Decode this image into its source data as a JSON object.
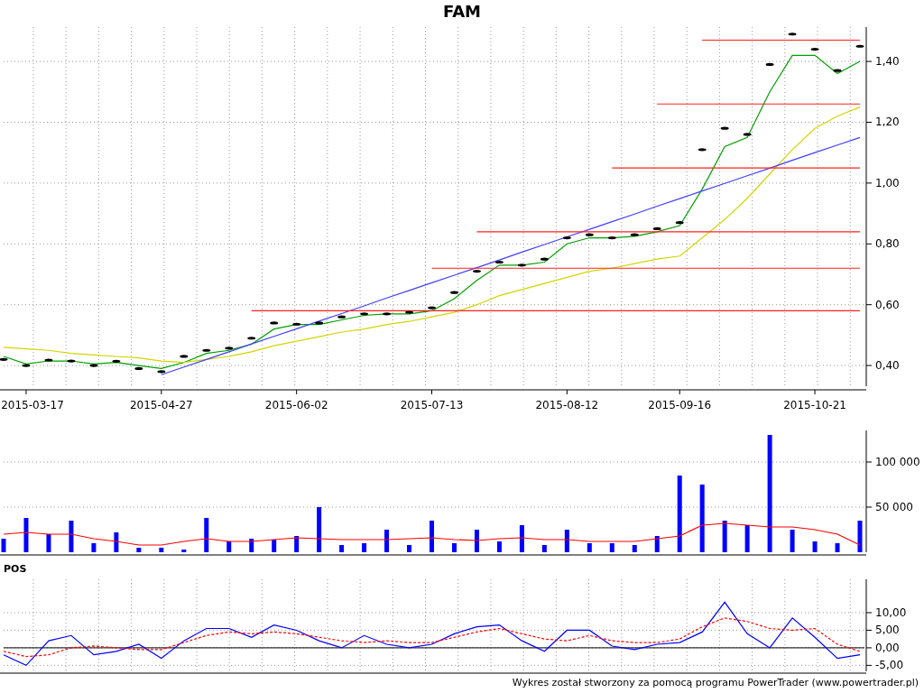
{
  "price_chart": {
    "chart_data": {
      "type": "line",
      "title": "FAM",
      "categories": [
        null,
        "2015-03-17",
        null,
        null,
        null,
        null,
        null,
        "2015-04-27",
        null,
        null,
        null,
        null,
        null,
        "2015-06-02",
        null,
        null,
        null,
        null,
        null,
        "2015-07-13",
        null,
        null,
        null,
        null,
        null,
        "2015-08-12",
        null,
        null,
        null,
        null,
        "2015-09-16",
        null,
        null,
        null,
        null,
        null,
        "2015-10-21",
        null,
        null
      ],
      "series": [
        {
          "color": "#000000",
          "type": "scatter",
          "values": [
            0.42,
            0.4,
            0.418,
            0.415,
            0.4,
            0.414,
            0.39,
            0.38,
            0.43,
            0.45,
            0.457,
            0.49,
            0.54,
            0.536,
            0.54,
            0.56,
            0.57,
            0.57,
            0.575,
            0.59,
            0.64,
            0.71,
            0.74,
            0.73,
            0.75,
            0.82,
            0.83,
            0.82,
            0.83,
            0.85,
            0.87,
            1.11,
            1.18,
            1.16,
            1.39,
            1.49,
            1.44,
            1.37,
            1.45
          ]
        },
        {
          "color": "#00a000",
          "values": [
            0.43,
            0.405,
            0.415,
            0.415,
            0.405,
            0.41,
            0.4,
            0.39,
            0.41,
            0.44,
            0.45,
            0.47,
            0.52,
            0.535,
            0.535,
            0.55,
            0.565,
            0.57,
            0.57,
            0.58,
            0.62,
            0.68,
            0.73,
            0.73,
            0.74,
            0.8,
            0.82,
            0.82,
            0.825,
            0.84,
            0.86,
            0.98,
            1.12,
            1.15,
            1.3,
            1.42,
            1.42,
            1.36,
            1.4
          ]
        },
        {
          "color": "#d4d400",
          "values": [
            0.46,
            0.455,
            0.45,
            0.44,
            0.435,
            0.43,
            0.425,
            0.415,
            0.41,
            0.42,
            0.43,
            0.445,
            0.465,
            0.48,
            0.495,
            0.51,
            0.52,
            0.535,
            0.545,
            0.56,
            0.575,
            0.6,
            0.63,
            0.65,
            0.67,
            0.69,
            0.71,
            0.72,
            0.735,
            0.75,
            0.76,
            0.82,
            0.88,
            0.95,
            1.03,
            1.11,
            1.18,
            1.22,
            1.25
          ]
        },
        {
          "color": "#4040ff",
          "values": [
            null,
            null,
            null,
            null,
            null,
            null,
            null,
            0.37,
            0.395,
            0.42,
            0.445,
            0.471,
            0.496,
            0.521,
            0.546,
            0.571,
            0.596,
            0.622,
            0.647,
            0.672,
            0.697,
            0.722,
            0.747,
            0.773,
            0.798,
            0.823,
            0.848,
            0.873,
            0.898,
            0.924,
            0.949,
            0.974,
            0.999,
            1.024,
            1.049,
            1.075,
            1.1,
            1.125,
            1.15
          ]
        },
        {
          "color": "#ff2020",
          "values": [
            null,
            null,
            null,
            null,
            null,
            null,
            null,
            null,
            null,
            null,
            null,
            null,
            null,
            null,
            null,
            null,
            null,
            null,
            null,
            null,
            null,
            null,
            null,
            null,
            null,
            null,
            null,
            null,
            null,
            null,
            null,
            1.47,
            1.47,
            1.47,
            1.47,
            1.47,
            1.47,
            1.47,
            1.47
          ]
        },
        {
          "color": "#ff2020",
          "values": [
            null,
            null,
            null,
            null,
            null,
            null,
            null,
            null,
            null,
            null,
            null,
            null,
            null,
            null,
            null,
            null,
            null,
            null,
            null,
            null,
            null,
            null,
            null,
            null,
            null,
            null,
            null,
            null,
            null,
            1.26,
            1.26,
            1.26,
            1.26,
            1.26,
            1.26,
            1.26,
            1.26,
            1.26,
            1.26
          ]
        },
        {
          "color": "#ff2020",
          "values": [
            null,
            null,
            null,
            null,
            null,
            null,
            null,
            null,
            null,
            null,
            null,
            null,
            null,
            null,
            null,
            null,
            null,
            null,
            null,
            null,
            null,
            null,
            null,
            null,
            null,
            null,
            null,
            1.05,
            1.05,
            1.05,
            1.05,
            1.05,
            1.05,
            1.05,
            1.05,
            1.05,
            1.05,
            1.05,
            1.05
          ]
        },
        {
          "color": "#ff2020",
          "values": [
            null,
            null,
            null,
            null,
            null,
            null,
            null,
            null,
            null,
            null,
            null,
            null,
            null,
            null,
            null,
            null,
            null,
            null,
            null,
            null,
            null,
            0.84,
            0.84,
            0.84,
            0.84,
            0.84,
            0.84,
            0.84,
            0.84,
            0.84,
            0.84,
            0.84,
            0.84,
            0.84,
            0.84,
            0.84,
            0.84,
            0.84,
            0.84
          ]
        },
        {
          "color": "#ff2020",
          "values": [
            null,
            null,
            null,
            null,
            null,
            null,
            null,
            null,
            null,
            null,
            null,
            null,
            null,
            null,
            null,
            null,
            null,
            null,
            null,
            0.72,
            0.72,
            0.72,
            0.72,
            0.72,
            0.72,
            0.72,
            0.72,
            0.72,
            0.72,
            0.72,
            0.72,
            0.72,
            0.72,
            0.72,
            0.72,
            0.72,
            0.72,
            0.72,
            0.72
          ]
        },
        {
          "color": "#ff2020",
          "values": [
            null,
            null,
            null,
            null,
            null,
            null,
            null,
            null,
            null,
            null,
            null,
            0.58,
            0.58,
            0.58,
            0.58,
            0.58,
            0.58,
            0.58,
            0.58,
            0.58,
            0.58,
            0.58,
            0.58,
            0.58,
            0.58,
            0.58,
            0.58,
            0.58,
            0.58,
            0.58,
            0.58,
            0.58,
            0.58,
            0.58,
            0.58,
            0.58,
            0.58,
            0.58,
            0.58
          ]
        }
      ],
      "ylim": [
        0.332,
        1.513
      ],
      "grid": true,
      "yticks": [
        {
          "value": 0.4,
          "label": "0,40"
        },
        {
          "value": 0.6,
          "label": "0,60"
        },
        {
          "value": 0.8,
          "label": "0,80"
        },
        {
          "value": 1.0,
          "label": "1,00"
        },
        {
          "value": 1.2,
          "label": "1,20"
        },
        {
          "value": 1.4,
          "label": "1,40"
        }
      ]
    }
  },
  "volume_chart": {
    "chart_data": {
      "type": "bar",
      "categories": [
        null,
        null,
        null,
        null,
        null,
        null,
        null,
        null,
        null,
        null,
        null,
        null,
        null,
        null,
        null,
        null,
        null,
        null,
        null,
        null,
        null,
        null,
        null,
        null,
        null,
        null,
        null,
        null,
        null,
        null,
        null,
        null,
        null,
        null,
        null,
        null,
        null,
        null,
        null
      ],
      "series": [
        {
          "color": "#0000ff",
          "values": [
            15000,
            38000,
            20000,
            35000,
            10000,
            22000,
            5000,
            5000,
            3000,
            38000,
            12000,
            15000,
            14000,
            18000,
            50000,
            8000,
            10000,
            25000,
            8000,
            35000,
            10000,
            25000,
            12000,
            30000,
            8000,
            25000,
            10000,
            10000,
            8000,
            18000,
            85000,
            75000,
            35000,
            30000,
            130000,
            25000,
            12000,
            10000,
            35000
          ]
        },
        {
          "color": "#ff0000",
          "type": "line",
          "values": [
            20000,
            22000,
            20000,
            20000,
            15000,
            12000,
            8000,
            8000,
            12000,
            15000,
            12000,
            12000,
            14000,
            16000,
            15000,
            14000,
            14000,
            14000,
            15000,
            16000,
            14000,
            13000,
            15000,
            16000,
            14000,
            14000,
            12000,
            12000,
            12000,
            15000,
            18000,
            30000,
            32000,
            30000,
            28000,
            28000,
            25000,
            20000,
            8000
          ]
        }
      ],
      "ylim": [
        0,
        135000
      ],
      "grid": true,
      "yticks": [
        {
          "value": 50000,
          "label": "50 000"
        },
        {
          "value": 100000,
          "label": "100 000"
        }
      ]
    }
  },
  "pos_chart": {
    "chart_data": {
      "type": "line",
      "title": "POS",
      "categories": [
        null,
        null,
        null,
        null,
        null,
        null,
        null,
        null,
        null,
        null,
        null,
        null,
        null,
        null,
        null,
        null,
        null,
        null,
        null,
        null,
        null,
        null,
        null,
        null,
        null,
        null,
        null,
        null,
        null,
        null,
        null,
        null,
        null,
        null,
        null,
        null,
        null,
        null,
        null
      ],
      "series": [
        {
          "color": "#0000ff",
          "values": [
            -2,
            -5,
            2,
            3.5,
            -2,
            -1,
            1,
            -3,
            2,
            5.5,
            5.5,
            3,
            6.5,
            5,
            2,
            0,
            3.5,
            1,
            0,
            1,
            4,
            6,
            6.5,
            2,
            -1,
            5,
            5,
            0.5,
            -0.5,
            1,
            1.5,
            4.5,
            13,
            4,
            0,
            8.5,
            3,
            -3,
            -2
          ]
        },
        {
          "color": "#ff0000",
          "line_style": "dashed",
          "values": [
            -1,
            -2.5,
            -2,
            0,
            0.5,
            0,
            -0.5,
            -0.5,
            1.5,
            3.5,
            4.5,
            4,
            4.5,
            4,
            3,
            2,
            1.5,
            2,
            1.5,
            1.5,
            3,
            4.5,
            5.5,
            4,
            2.5,
            2,
            3.5,
            2,
            1.5,
            1.5,
            2.5,
            6,
            8.5,
            7.5,
            5.5,
            5,
            5.5,
            1,
            -1
          ]
        }
      ],
      "ylim": [
        -6.7,
        19.5
      ],
      "grid": true,
      "yticks": [
        {
          "value": -5,
          "label": "-5,00"
        },
        {
          "value": 0,
          "label": "0,00"
        },
        {
          "value": 5,
          "label": "5,00"
        },
        {
          "value": 10,
          "label": "10,00"
        }
      ]
    }
  },
  "footer": "Wykres został stworzony za pomocą programu PowerTrader (www.powertrader.pl)"
}
